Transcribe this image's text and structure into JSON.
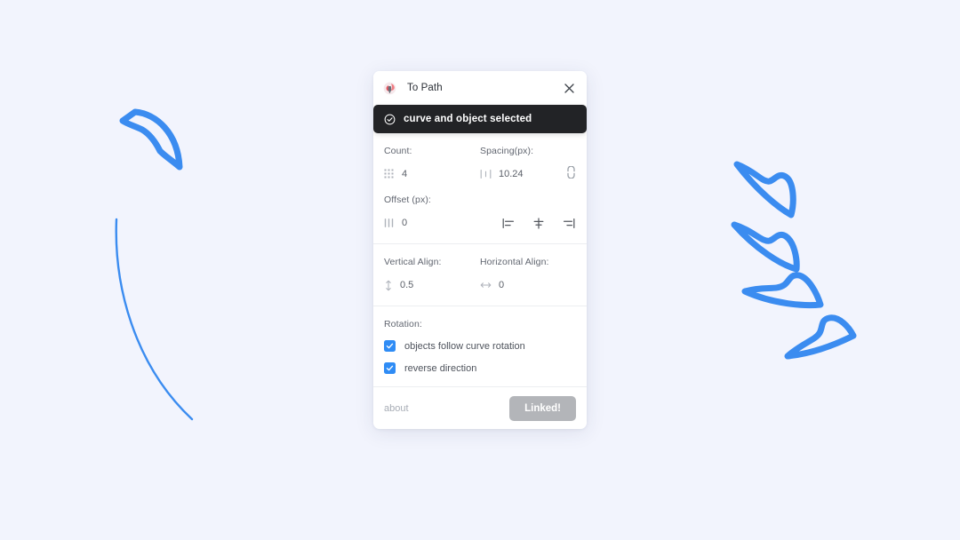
{
  "canvas": {
    "background_color": "#f2f4fd",
    "stroke_color": "#3b8cf0",
    "description": "design canvas with a bezier curve path and leaf shapes distributed along it"
  },
  "panel": {
    "titlebar": {
      "logo_icon": "plugin-logo-icon",
      "title": "To Path",
      "close_icon": "close-icon"
    },
    "toast": {
      "icon": "check-circle-icon",
      "message": "curve and object selected",
      "background_color": "#222326",
      "text_color": "#ffffff"
    },
    "count": {
      "label": "Count:",
      "icon": "grid-dots-icon",
      "value": "4"
    },
    "spacing": {
      "label": "Spacing(px):",
      "icon": "spacing-icon",
      "value": "10.24",
      "link_icon": "broken-link-icon"
    },
    "offset": {
      "label": "Offset (px):",
      "icon": "vertical-bars-icon",
      "value": "0",
      "align_buttons": [
        {
          "name": "align-start-button",
          "icon": "align-start-icon"
        },
        {
          "name": "align-center-button",
          "icon": "align-center-icon"
        },
        {
          "name": "align-end-button",
          "icon": "align-end-icon"
        }
      ]
    },
    "vertical_align": {
      "label": "Vertical Align:",
      "icon": "arrows-vertical-icon",
      "value": "0.5"
    },
    "horizontal_align": {
      "label": "Horizontal Align:",
      "icon": "arrows-horizontal-icon",
      "value": "0"
    },
    "rotation": {
      "label": "Rotation:",
      "checkboxes": [
        {
          "label": "objects follow curve rotation",
          "checked": true
        },
        {
          "label": "reverse direction",
          "checked": true
        }
      ],
      "checkbox_color": "#2f8cf5"
    },
    "footer": {
      "about_label": "about",
      "action_label": "Linked!",
      "action_color": "#b3b5b9"
    }
  }
}
